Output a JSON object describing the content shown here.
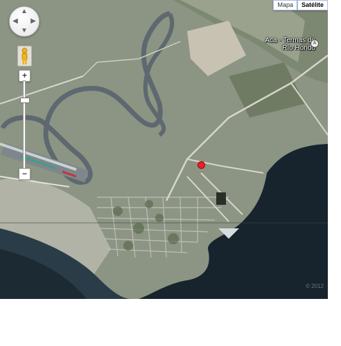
{
  "map": {
    "type_control": {
      "map_label": "Mapa",
      "satellite_label": "Satélite",
      "active": "Satélite"
    },
    "place": {
      "name": "Aca - Termas de Río Hondo",
      "icon": "A"
    },
    "controls": {
      "zoom_in": "+",
      "zoom_out": "−",
      "pan_icons": [
        "▲",
        "▼",
        "◀",
        "▶"
      ]
    },
    "copyright": "© 2012",
    "colors": {
      "lake": "#15222b",
      "land": "#8f9885",
      "track": "#6b757c",
      "marker": "#e8202a"
    }
  }
}
